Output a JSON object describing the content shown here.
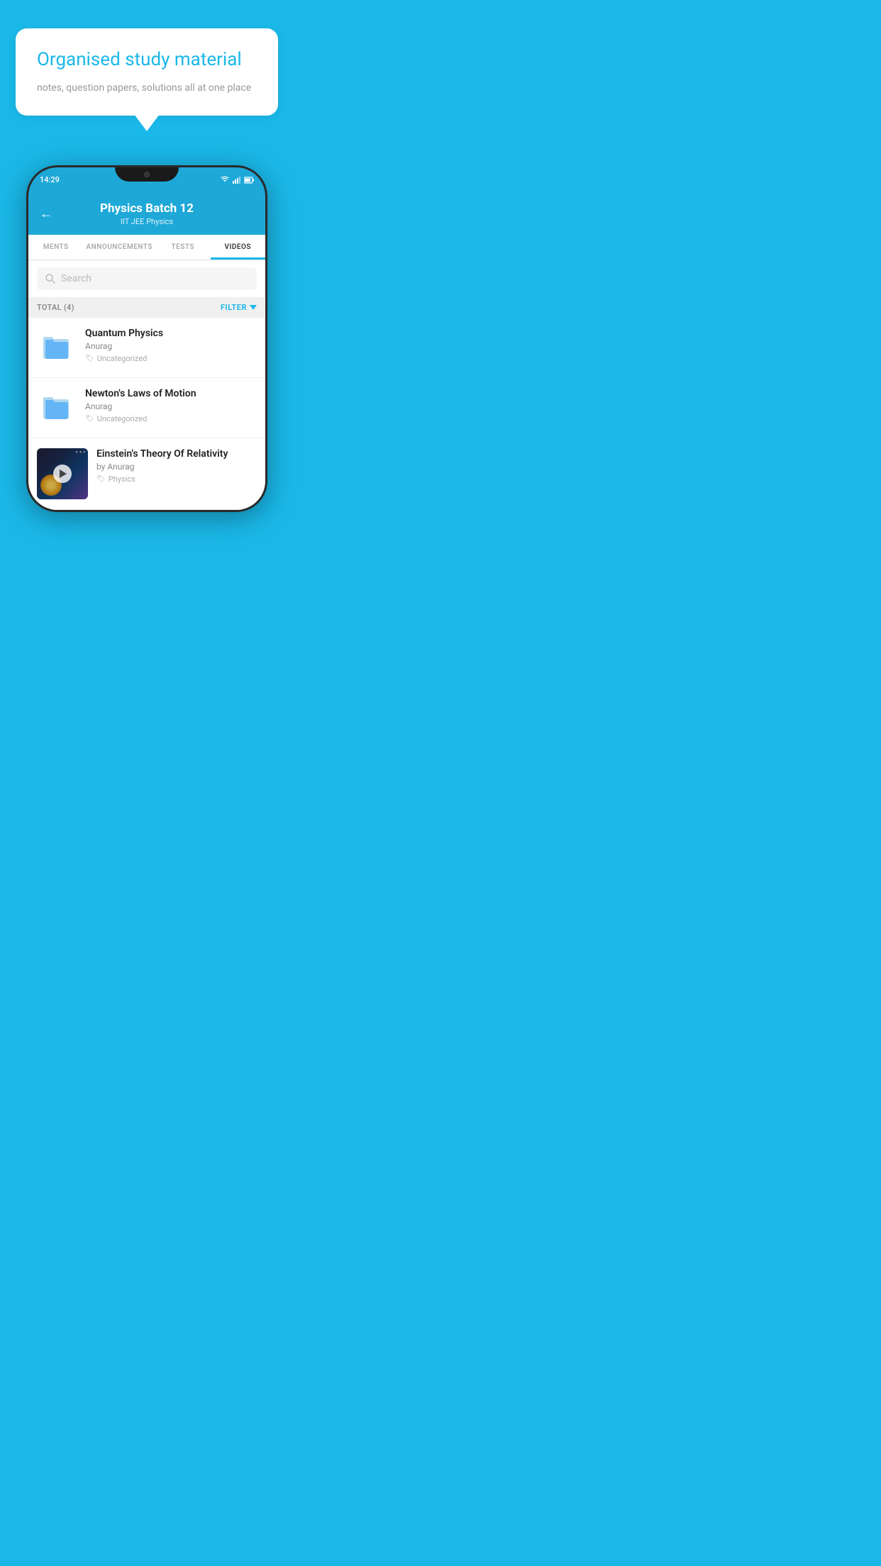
{
  "background_color": "#1ab8e8",
  "bubble": {
    "title": "Organised study material",
    "subtitle": "notes, question papers, solutions all at one place"
  },
  "phone": {
    "status_bar": {
      "time": "14:29",
      "icons": [
        "wifi",
        "signal",
        "battery"
      ]
    },
    "header": {
      "back_label": "←",
      "title": "Physics Batch 12",
      "subtitle": "IIT JEE   Physics"
    },
    "tabs": [
      {
        "label": "MENTS",
        "active": false
      },
      {
        "label": "ANNOUNCEMENTS",
        "active": false
      },
      {
        "label": "TESTS",
        "active": false
      },
      {
        "label": "VIDEOS",
        "active": true
      }
    ],
    "search": {
      "placeholder": "Search"
    },
    "filter_bar": {
      "total_label": "TOTAL (4)",
      "filter_label": "FILTER"
    },
    "videos": [
      {
        "id": 1,
        "title": "Quantum Physics",
        "author": "Anurag",
        "tag": "Uncategorized",
        "type": "folder",
        "has_thumbnail": false
      },
      {
        "id": 2,
        "title": "Newton's Laws of Motion",
        "author": "Anurag",
        "tag": "Uncategorized",
        "type": "folder",
        "has_thumbnail": false
      },
      {
        "id": 3,
        "title": "Einstein's Theory Of Relativity",
        "author": "by Anurag",
        "tag": "Physics",
        "type": "video",
        "has_thumbnail": true
      }
    ]
  }
}
